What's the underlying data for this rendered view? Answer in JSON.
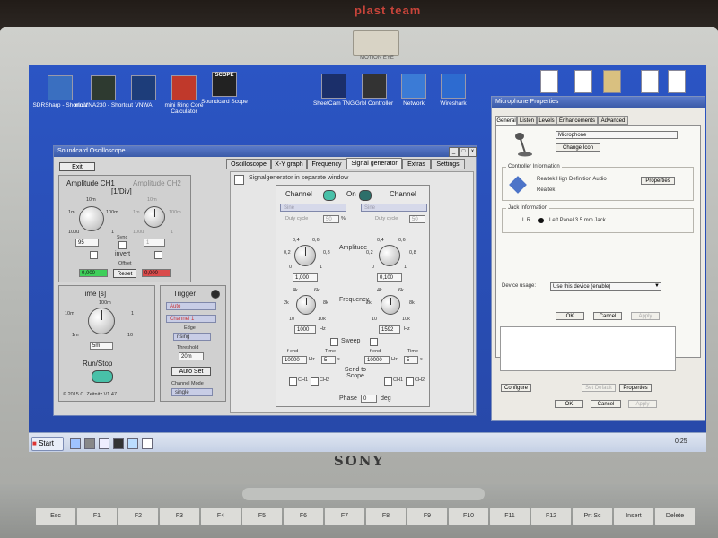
{
  "wall": {
    "sign_text": "plast team"
  },
  "laptop": {
    "brand": "SONY",
    "model_sticker": "MOTION EYE",
    "keys": [
      "Esc",
      "F1",
      "F2",
      "F3",
      "F4",
      "F5",
      "F6",
      "F7",
      "F8",
      "F9",
      "F10",
      "F11",
      "F12",
      "Prt Sc",
      "Insert",
      "Delete"
    ]
  },
  "desktop": {
    "icons": [
      {
        "label": "SDRSharp - Shortcut",
        "icon": "sdrsharp-icon",
        "color": "#3a6fc0"
      },
      {
        "label": "miniVNA230 - Shortcut",
        "icon": "vna-icon",
        "color": "#2e3a30"
      },
      {
        "label": "VNWA",
        "icon": "vnwa-icon",
        "color": "#1d3d7a"
      },
      {
        "label": "mini Ring Core Calculator",
        "icon": "ring-core-icon",
        "color": "#c0392b"
      },
      {
        "label": "Soundcard Scope",
        "icon": "scope-icon",
        "color": "#222222",
        "overlay": "SCOPE"
      },
      {
        "label": "SheetCam TNG",
        "icon": "sheetcam-icon",
        "color": "#1b2f6a"
      },
      {
        "label": "Grbl Controller",
        "icon": "grbl-icon",
        "color": "#333333"
      },
      {
        "label": "Network",
        "icon": "network-icon",
        "color": "#3b7bd6"
      },
      {
        "label": "Wireshark",
        "icon": "wireshark-icon",
        "color": "#2d6bd0"
      }
    ]
  },
  "taskbar": {
    "start_label": "Start",
    "clock": "0:25"
  },
  "oscilloscope": {
    "title": "Soundcard Oscilloscope",
    "exit_label": "Exit",
    "tabs": [
      "Oscilloscope",
      "X-Y graph",
      "Frequency",
      "Signal generator",
      "Extras",
      "Settings"
    ],
    "active_tab": "Signal generator",
    "amplitude": {
      "ch1_label": "Amplitude CH1",
      "ch2_label": "Amplitude CH2",
      "unit": "[1/Div]",
      "scale_top": "10m",
      "scale_left1": "1m",
      "scale_right1": "100m",
      "scale_left2": "100u",
      "scale_right2": "1",
      "ch1_value": "95",
      "ch2_value": "1",
      "sync_label": "Sync",
      "invert_label": "invert",
      "offset_label": "Offset",
      "offset_ch1": "0,000",
      "offset_ch2": "0,000",
      "reset_label": "Reset"
    },
    "time": {
      "label": "Time [s]",
      "scale_top": "100m",
      "scale_left": "10m",
      "scale_right": "1",
      "scale_bl": "1m",
      "scale_br": "10",
      "value": "5m"
    },
    "runstop_label": "Run/Stop",
    "trigger": {
      "label": "Trigger",
      "mode": "Auto",
      "channel": "Channel 1",
      "edge_label": "Edge",
      "edge": "rising",
      "threshold_label": "Threshold",
      "threshold_value": "20m",
      "auto_set_label": "Auto Set",
      "channel_mode_label": "Channel Mode",
      "channel_mode": "single"
    },
    "copyright": "© 2015 C. Zeitnitz V1.47",
    "siggen": {
      "separate_window_label": "Signalgenerator in separate window",
      "channel_label": "Channel",
      "on_label": "On",
      "wave_left": "Sine",
      "wave_right": "Sine",
      "duty_label": "Duty cycle",
      "duty_left": "50",
      "duty_right": "50",
      "duty_unit": "%",
      "amplitude_label": "Amplitude",
      "amp_scale_top_l": "0,4",
      "amp_scale_top_r": "0,6",
      "amp_scale_mid_l": "0,2",
      "amp_scale_mid_r": "0,8",
      "amp_scale_bot_l": "0",
      "amp_scale_bot_r": "1",
      "amp_left": "1,000",
      "amp_right": "0,100",
      "frequency_label": "Frequency",
      "freq_scale_tl": "4k",
      "freq_scale_tr": "6k",
      "freq_scale_ml": "2k",
      "freq_scale_mr": "8k",
      "freq_scale_bl": "10",
      "freq_scale_br": "10k",
      "freq_left": "1000",
      "freq_right": "1592",
      "hz": "Hz",
      "sweep_label": "Sweep",
      "fend_label": "f end",
      "time_label": "Time",
      "fend_left": "10000",
      "fend_right": "10000",
      "sweep_time_left": "5",
      "sweep_time_right": "5",
      "s_unit": "s",
      "send_label": "Send to Scope",
      "ch1": "CH1",
      "ch2": "CH2",
      "phase_label": "Phase",
      "phase_value": "0",
      "deg": "deg"
    }
  },
  "mic": {
    "title": "Microphone Properties",
    "tabs": [
      "General",
      "Listen",
      "Levels",
      "Enhancements",
      "Advanced"
    ],
    "name_value": "Microphone",
    "change_icon_label": "Change Icon",
    "controller_info_label": "Controller Information",
    "controller_name": "Realtek High Definition Audio",
    "controller_vendor": "Realtek",
    "properties_label": "Properties",
    "jack_info_label": "Jack Information",
    "jack_lr": "L R",
    "jack_desc": "Left Panel 3.5 mm Jack",
    "device_usage_label": "Device usage:",
    "device_usage_value": "Use this device (enable)",
    "ok_label": "OK",
    "cancel_label": "Cancel",
    "apply_label": "Apply",
    "configure_label": "Configure",
    "set_default_label": "Set Default"
  }
}
